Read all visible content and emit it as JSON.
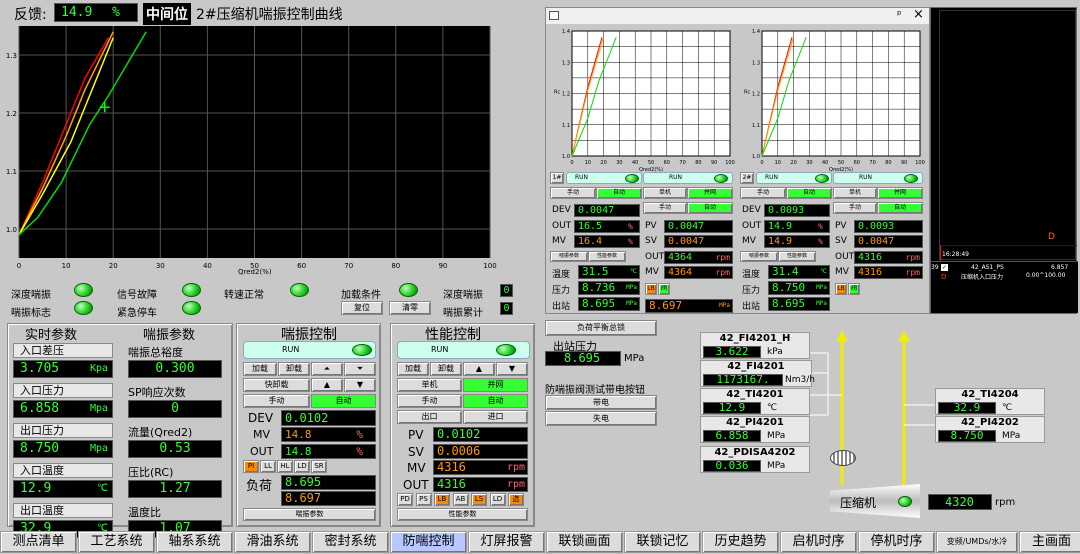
{
  "header": {
    "feedback_label": "反馈:",
    "feedback_value": "14.9",
    "feedback_unit": "%",
    "mid_label": "中间位",
    "title": "2#压缩机喘振控制曲线"
  },
  "main_chart": {
    "x_ticks": [
      "0",
      "10",
      "20",
      "30",
      "40",
      "50",
      "60",
      "70",
      "80",
      "90",
      "100"
    ],
    "y_ticks": [
      "1.3",
      "1.2",
      "1.1",
      "1.0"
    ],
    "xlabel": "Qred2(%)"
  },
  "chart_data": [
    {
      "type": "line",
      "xlabel": "Qred2(%)",
      "xlim": [
        0,
        100
      ],
      "ylim": [
        0.95,
        1.35
      ],
      "grid": true,
      "series": [
        {
          "color": "#ff0000",
          "x": [
            0,
            5,
            10,
            14,
            19
          ],
          "y": [
            0.99,
            1.08,
            1.18,
            1.26,
            1.33
          ]
        },
        {
          "color": "#ffa500",
          "x": [
            0,
            5,
            10,
            14,
            20
          ],
          "y": [
            0.99,
            1.07,
            1.16,
            1.24,
            1.34
          ]
        },
        {
          "color": "#ffff00",
          "x": [
            0,
            5,
            11,
            15,
            20
          ],
          "y": [
            0.99,
            1.06,
            1.15,
            1.23,
            1.33
          ]
        },
        {
          "color": "#00dd00",
          "x": [
            0,
            4,
            9,
            15,
            19,
            27
          ],
          "y": [
            0.99,
            1.02,
            1.08,
            1.18,
            1.23,
            1.34
          ]
        }
      ],
      "annotations": [
        {
          "type": "operating-point",
          "x": 18.2,
          "y": 1.21
        }
      ]
    },
    {
      "type": "line",
      "xlabel": "Qred2(%)",
      "ylabel": "Rc",
      "xlim": [
        0,
        100
      ],
      "ylim": [
        1.0,
        1.4
      ],
      "series": [
        {
          "color": "#ff0000",
          "x": [
            0,
            10,
            19
          ],
          "y": [
            1.0,
            1.22,
            1.38
          ]
        },
        {
          "color": "#ffa500",
          "x": [
            0,
            10,
            20
          ],
          "y": [
            1.0,
            1.21,
            1.38
          ]
        },
        {
          "color": "#00dd00",
          "x": [
            0,
            10,
            17,
            28
          ],
          "y": [
            1.0,
            1.12,
            1.24,
            1.38
          ]
        }
      ]
    },
    {
      "type": "line",
      "xlabel": "Qred2(%)",
      "ylabel": "Rc",
      "xlim": [
        0,
        100
      ],
      "ylim": [
        1.0,
        1.4
      ],
      "series": [
        {
          "color": "#ff0000",
          "x": [
            0,
            10,
            19
          ],
          "y": [
            1.0,
            1.22,
            1.38
          ]
        },
        {
          "color": "#ffa500",
          "x": [
            0,
            10,
            20
          ],
          "y": [
            1.0,
            1.21,
            1.38
          ]
        },
        {
          "color": "#00dd00",
          "x": [
            0,
            10,
            17,
            28
          ],
          "y": [
            1.0,
            1.12,
            1.24,
            1.38
          ]
        }
      ]
    }
  ],
  "status": {
    "row1": [
      "深度喘振",
      "信号故障",
      "转速正常",
      "加载条件",
      "深度喘振"
    ],
    "row2": [
      "喘振标志",
      "紧急停车"
    ],
    "reset": "复位",
    "clear": "清零",
    "count_label": "喘振累计",
    "count1": "0",
    "count2": "0"
  },
  "realtime": {
    "title": "实时参数",
    "items": [
      {
        "label": "入口差压",
        "value": "3.705",
        "unit": "Kpa"
      },
      {
        "label": "入口压力",
        "value": "6.858",
        "unit": "Mpa"
      },
      {
        "label": "出口压力",
        "value": "8.750",
        "unit": "Mpa"
      },
      {
        "label": "入口温度",
        "value": "12.9",
        "unit": "℃"
      },
      {
        "label": "出口温度",
        "value": "32.9",
        "unit": "℃"
      }
    ]
  },
  "surge_params": {
    "title": "喘振参数",
    "items": [
      {
        "label": "喘振总裕度",
        "value": "0.300"
      },
      {
        "label": "SP响应次数",
        "value": "0"
      },
      {
        "label": "流量(Qred2)",
        "value": "0.53"
      },
      {
        "label": "压比(RC)",
        "value": "1.27"
      },
      {
        "label": "温度比",
        "value": "1.07"
      }
    ]
  },
  "surge_ctrl": {
    "title": "喘振控制",
    "run": "RUN",
    "load": "加载",
    "unload": "卸载",
    "fast_unload": "快卸载",
    "manual": "手动",
    "auto": "自动",
    "dev_label": "DEV",
    "dev": "0.0102",
    "mv_label": "MV",
    "mv": "14.8",
    "mv_unit": "%",
    "out_label": "OUT",
    "out": "14.8",
    "out_unit": "%",
    "flags": [
      "PI",
      "LL",
      "HL",
      "LD",
      "SR"
    ],
    "load_label": "负荷",
    "load1": "8.695",
    "load2": "8.697",
    "params_btn": "喘振参数"
  },
  "perf_ctrl": {
    "title": "性能控制",
    "run": "RUN",
    "single": "单机",
    "parallel": "并网",
    "manual": "手动",
    "auto": "自动",
    "out_btn": "出口",
    "in_btn": "进口",
    "pv_label": "PV",
    "pv": "0.0102",
    "sv_label": "SV",
    "sv": "0.0006",
    "mv_label": "MV",
    "mv": "4316",
    "out_label": "OUT",
    "out": "4316",
    "rpm": "rpm",
    "flags": [
      "PD",
      "PS",
      "LB",
      "AB",
      "LS",
      "LD",
      "选"
    ],
    "params_btn": "性能参数"
  },
  "popup": {
    "pin": "ᵖ",
    "close": "×",
    "units": [
      {
        "tag": "1#",
        "run": "RUN",
        "manual": "手动",
        "auto": "自动",
        "single": "单机",
        "parallel": "并网",
        "dev": "0.0047",
        "out": "16.5",
        "mv": "16.4",
        "pv": "0.0047",
        "sv": "0.0047",
        "mv2": "4364",
        "out2": "4364",
        "temp": "31.5",
        "press": "8.736",
        "outp": "8.695",
        "outp2": "8.697",
        "unit_pct": "%",
        "unit_c": "℃",
        "unit_mpa": "MPa",
        "rpm": "rpm",
        "surge_btn": "喘振参数",
        "perf_btn": "性能参数",
        "lb": "LB",
        "bh": "阀",
        "temp_label": "温度",
        "press_label": "压力",
        "out_label": "出站"
      },
      {
        "tag": "2#",
        "run": "RUN",
        "manual": "手动",
        "auto": "自动",
        "single": "单机",
        "parallel": "并网",
        "dev": "0.0093",
        "out": "14.9",
        "mv": "14.9",
        "pv": "0.0093",
        "sv": "0.0047",
        "mv2": "4316",
        "out2": "4316",
        "temp": "31.4",
        "press": "8.750",
        "outp": "8.695",
        "outp2": "",
        "unit_pct": "%",
        "unit_c": "℃",
        "unit_mpa": "MPa",
        "rpm": "rpm",
        "surge_btn": "喘振参数",
        "perf_btn": "性能参数",
        "lb": "LB",
        "bh": "阀",
        "temp_label": "温度",
        "press_label": "压力",
        "out_label": "出站"
      }
    ]
  },
  "trend": {
    "time": "16:28:49",
    "tag": "42_AS1_PS",
    "value": "6.857",
    "desc": "压缩机入口压力",
    "range": "0.00^100.00",
    "row": "39",
    "letter": "D"
  },
  "load_balance": {
    "btn": "负荷平衡总锁",
    "out_press_label": "出站压力",
    "out_press": "8.695",
    "unit": "MPa",
    "test_title": "防喘振阀测试带电按钮",
    "on": "带电",
    "off": "失电"
  },
  "schematic": {
    "tags": [
      {
        "name": "42_FI4201_H",
        "value": "3.622",
        "unit": "kPa"
      },
      {
        "name": "42_FI4201",
        "value": "1173167.",
        "unit": "Nm3/h"
      },
      {
        "name": "42_TI4201",
        "value": "12.9",
        "unit": "℃"
      },
      {
        "name": "42_PI4201",
        "value": "6.858",
        "unit": "MPa"
      },
      {
        "name": "42_PDISA4202",
        "value": "0.036",
        "unit": "MPa"
      },
      {
        "name": "42_TI4204",
        "value": "32.9",
        "unit": "℃"
      },
      {
        "name": "42_PI4202",
        "value": "8.750",
        "unit": "MPa"
      }
    ],
    "compressor": "压缩机",
    "speed": "4320",
    "speed_unit": "rpm"
  },
  "nav": [
    "测点清单",
    "工艺系统",
    "轴系系统",
    "滑油系统",
    "密封系统",
    "防喘控制",
    "灯屏报警",
    "联锁画面",
    "联锁记忆",
    "历史趋势",
    "启机时序",
    "停机时序",
    "变频/UMDs/水冷",
    "主画面"
  ]
}
